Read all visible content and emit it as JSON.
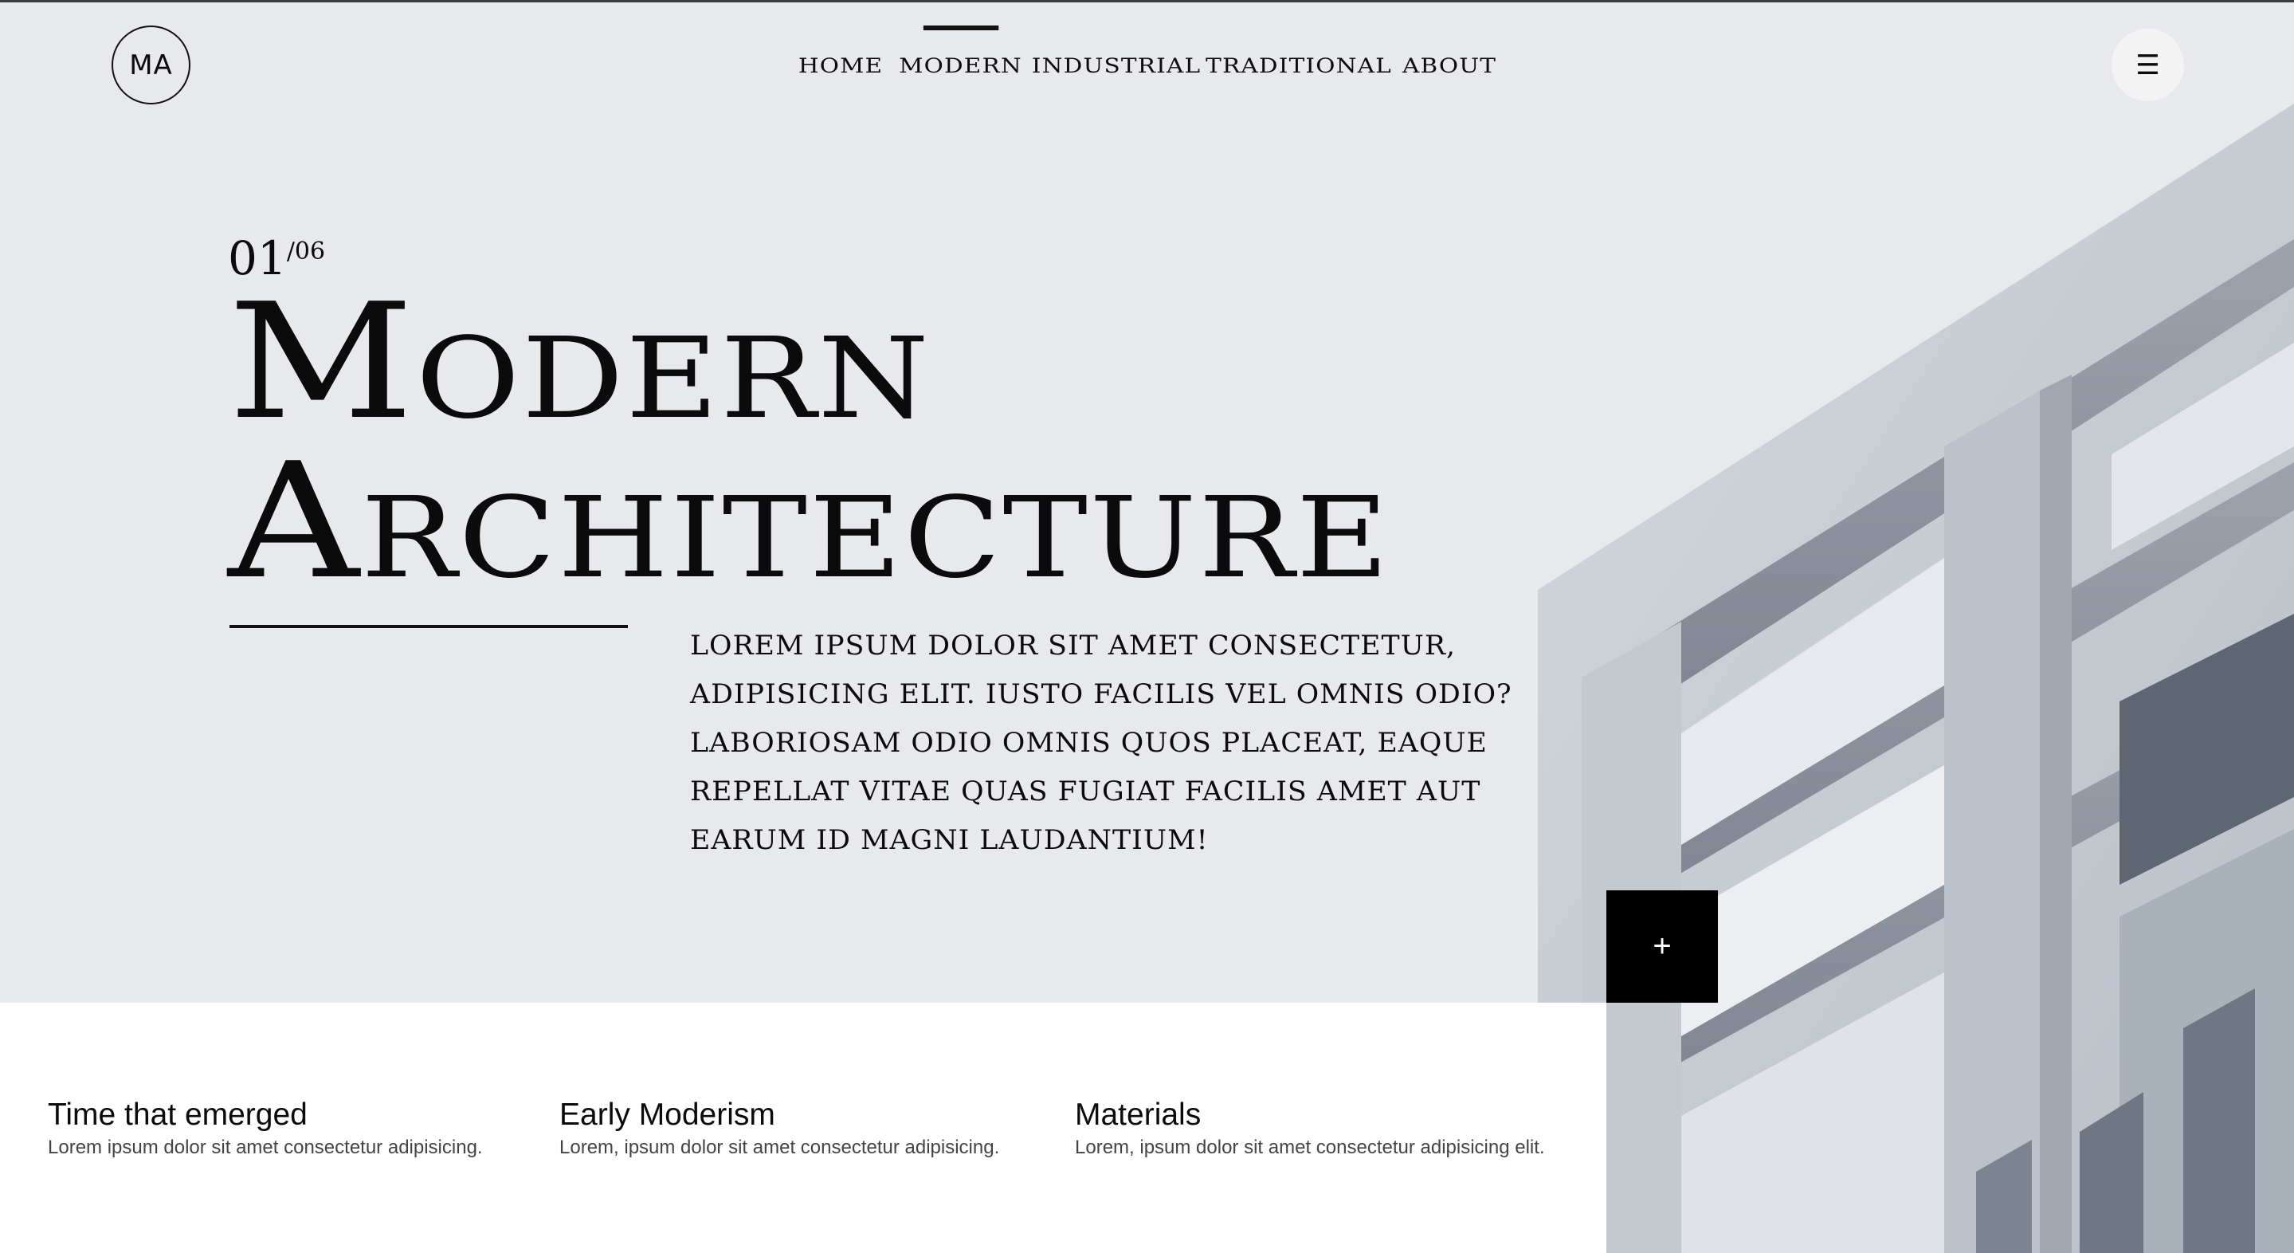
{
  "logo": {
    "text": "MA"
  },
  "nav": {
    "items": [
      {
        "label": "HOME"
      },
      {
        "label": "MODERN"
      },
      {
        "label": "INDUSTRIAL"
      },
      {
        "label": "TRADITIONAL"
      },
      {
        "label": "ABOUT"
      }
    ],
    "active": "MODERN"
  },
  "menu": {
    "icon": "hamburger-icon",
    "glyph": "☰"
  },
  "hero": {
    "counter_current": "01",
    "counter_total": "/06",
    "title_line1": "Modern",
    "title_line2": "Architecture",
    "lead": "Lorem ipsum dolor sit amet consectetur, adipisicing elit. Iusto facilis vel omnis odio? Laboriosam odio omnis quos placeat, eaque repellat vitae quas fugiat facilis amet aut earum id magni laudantium!"
  },
  "plus_button": {
    "icon": "plus-icon",
    "glyph": "+"
  },
  "features": [
    {
      "title": "Time that emerged",
      "text": "Lorem ipsum dolor sit amet consectetur adipisicing."
    },
    {
      "title": "Early Moderism",
      "text": "Lorem, ipsum dolor sit amet consectetur adipisicing."
    },
    {
      "title": "Materials",
      "text": "Lorem, ipsum dolor sit amet consectetur adipisicing elit."
    }
  ],
  "colors": {
    "background": "#e8e9ed",
    "ink": "#0b0b0b",
    "concrete": "#c8cdd3",
    "concrete_shadow": "#8c929c"
  }
}
